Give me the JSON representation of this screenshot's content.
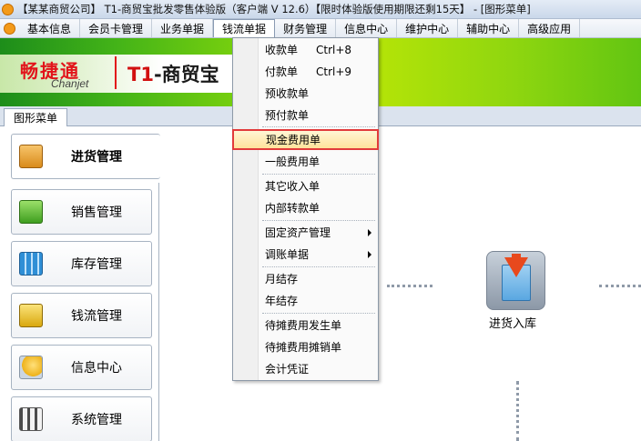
{
  "window": {
    "title": "【某某商贸公司】 T1-商贸宝批发零售体验版（客户端 V 12.6）【限时体验版使用期限还剩15天】 - [图形菜单]"
  },
  "menubar": {
    "items": [
      {
        "label": "基本信息"
      },
      {
        "label": "会员卡管理"
      },
      {
        "label": "业务单据"
      },
      {
        "label": "钱流单据"
      },
      {
        "label": "财务管理"
      },
      {
        "label": "信息中心"
      },
      {
        "label": "维护中心"
      },
      {
        "label": "辅助中心"
      },
      {
        "label": "高级应用"
      }
    ],
    "active_index": 3
  },
  "banner": {
    "brand_cn": "畅捷通",
    "brand_en": "Chanjet",
    "product_t1": "T1",
    "product_rest": "-商贸宝"
  },
  "tabs": [
    {
      "label": "图形菜单"
    }
  ],
  "nav": {
    "items": [
      {
        "label": "进货管理",
        "icon": "purchase-register-icon",
        "active": true
      },
      {
        "label": "销售管理",
        "icon": "shopping-basket-icon"
      },
      {
        "label": "库存管理",
        "icon": "inventory-grid-icon"
      },
      {
        "label": "钱流管理",
        "icon": "money-flow-icon"
      },
      {
        "label": "信息中心",
        "icon": "info-bulb-icon"
      },
      {
        "label": "系统管理",
        "icon": "settings-sliders-icon"
      }
    ]
  },
  "flow": {
    "node_label": "进货入库",
    "node_icon": "stock-in-icon"
  },
  "dropdown": {
    "items": [
      {
        "label": "收款单",
        "shortcut": "Ctrl+8"
      },
      {
        "label": "付款单",
        "shortcut": "Ctrl+9"
      },
      {
        "label": "预收款单"
      },
      {
        "label": "预付款单"
      },
      {
        "label": "现金费用单",
        "highlighted": true
      },
      {
        "label": "一般费用单"
      },
      {
        "label": "其它收入单"
      },
      {
        "label": "内部转款单"
      },
      {
        "label": "固定资产管理",
        "submenu": true
      },
      {
        "label": "调账单据",
        "submenu": true
      },
      {
        "label": "月结存"
      },
      {
        "label": "年结存"
      },
      {
        "label": "待摊费用发生单"
      },
      {
        "label": "待摊费用摊销单"
      },
      {
        "label": "会计凭证"
      }
    ]
  },
  "colors": {
    "highlight_border": "#e23b3b",
    "brand_red": "#e2141b",
    "banner_green": "#7fd40d"
  }
}
